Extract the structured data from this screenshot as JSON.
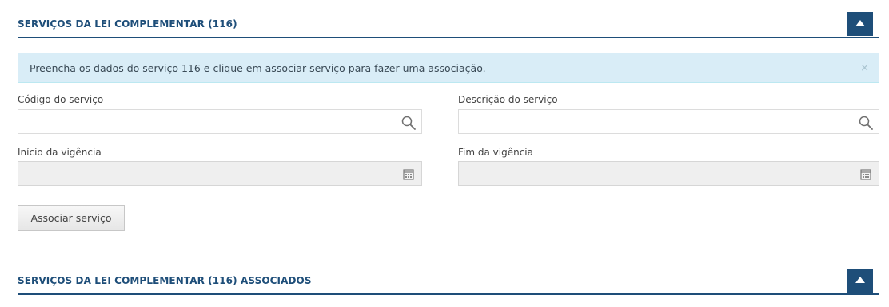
{
  "section_top": {
    "title": "SERVIÇOS DA LEI COMPLEMENTAR (116)"
  },
  "alert": {
    "message": "Preencha os dados do serviço 116 e clique em associar serviço para fazer uma associação.",
    "close": "×"
  },
  "form": {
    "codigo": {
      "label": "Código do serviço",
      "value": "",
      "icon": "search-icon"
    },
    "descricao": {
      "label": "Descrição do serviço",
      "value": "",
      "icon": "search-icon"
    },
    "inicio": {
      "label": "Início da vigência",
      "value": "",
      "icon": "calendar-icon"
    },
    "fim": {
      "label": "Fim da vigência",
      "value": "",
      "icon": "calendar-icon"
    }
  },
  "actions": {
    "associate_label": "Associar serviço"
  },
  "section_bottom": {
    "title": "SERVIÇOS DA LEI COMPLEMENTAR (116) ASSOCIADOS"
  },
  "colors": {
    "accent": "#1e4e79",
    "alert_bg": "#d9edf7",
    "disabled_bg": "#efefef"
  }
}
